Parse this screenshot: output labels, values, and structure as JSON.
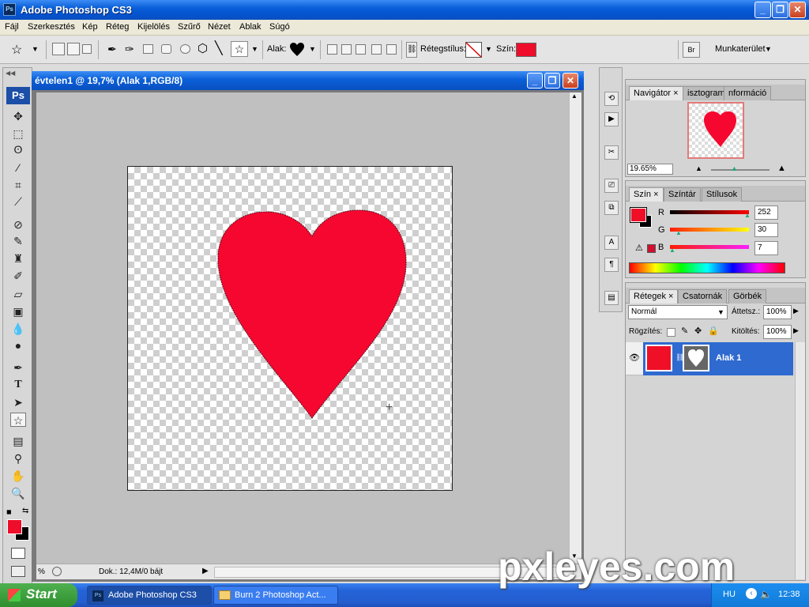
{
  "app": {
    "title": "Adobe Photoshop CS3",
    "icon": "ps-icon"
  },
  "window_controls": {
    "minimize": "_",
    "maximize": "❐",
    "close": "✕"
  },
  "menu": [
    "Fájl",
    "Szerkesztés",
    "Kép",
    "Réteg",
    "Kijelölés",
    "Szűrő",
    "Nézet",
    "Ablak",
    "Súgó"
  ],
  "options_bar": {
    "shape_label": "Alak:",
    "layer_style_label": "Rétegstílus:",
    "color_label": "Szín:",
    "shape_color": "#ee0d2a",
    "workspace": "Munkaterület"
  },
  "toolbox": {
    "logo": "Ps",
    "foreground_color": "#ee0d2a",
    "background_color": "#000000"
  },
  "document": {
    "title": "évtelen1 @ 19,7% (Alak 1,RGB/8)",
    "heart_color": "#f5072f",
    "status_zoom": "%",
    "status_doc": "Dok.: 12,4M/0 bájt"
  },
  "navigator_panel": {
    "tabs": [
      "Navigátor",
      "isztogram",
      "nformáció"
    ],
    "zoom_value": "19.65%"
  },
  "color_panel": {
    "tabs": [
      "Szín",
      "Színtár",
      "Stílusok"
    ],
    "r_label": "R",
    "g_label": "G",
    "b_label": "B",
    "r": "252",
    "g": "30",
    "b": "7",
    "swatch": "#ef0f27"
  },
  "layers_panel": {
    "tabs": [
      "Rétegek",
      "Csatornák",
      "Görbék"
    ],
    "blend_mode": "Normál",
    "opacity_label": "Áttetsz.:",
    "opacity": "100%",
    "lock_label": "Rögzítés:",
    "fill_label": "Kitöltés:",
    "fill": "100%",
    "layers": [
      {
        "name": "Alak 1",
        "visible": true,
        "selected": true
      }
    ]
  },
  "taskbar": {
    "start_label": "Start",
    "tasks": [
      "Adobe Photoshop CS3",
      "Burn 2 Photoshop Act..."
    ],
    "language": "HU",
    "clock": "12:38"
  },
  "watermark": "pxleyes.com"
}
